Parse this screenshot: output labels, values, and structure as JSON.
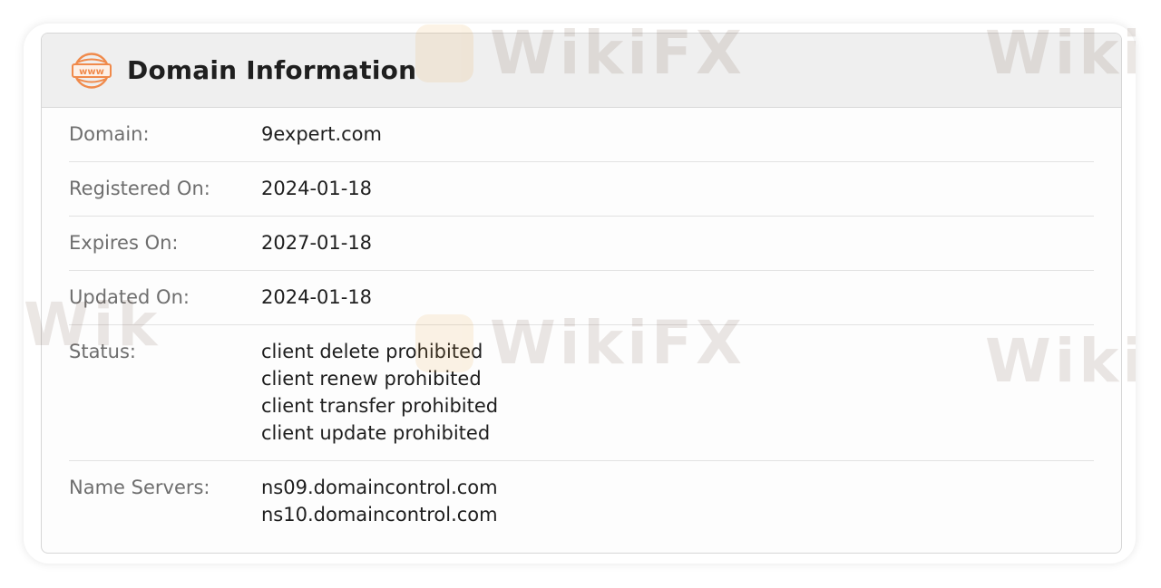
{
  "header": {
    "icon": "www-icon",
    "icon_text": "www",
    "title": "Domain Information"
  },
  "rows": [
    {
      "label": "Domain:",
      "values": [
        "9expert.com"
      ]
    },
    {
      "label": "Registered On:",
      "values": [
        "2024-01-18"
      ]
    },
    {
      "label": "Expires On:",
      "values": [
        "2027-01-18"
      ]
    },
    {
      "label": "Updated On:",
      "values": [
        "2024-01-18"
      ]
    },
    {
      "label": "Status:",
      "values": [
        "client delete prohibited",
        "client renew prohibited",
        "client transfer prohibited",
        "client update prohibited"
      ]
    },
    {
      "label": "Name Servers:",
      "values": [
        "ns09.domaincontrol.com",
        "ns10.domaincontrol.com"
      ]
    }
  ],
  "watermark": {
    "text": "WikiFX"
  },
  "colors": {
    "accent": "#f08a4b",
    "header_bg": "#efefef",
    "label": "#6e6e6e",
    "value": "#1e1e1e"
  }
}
